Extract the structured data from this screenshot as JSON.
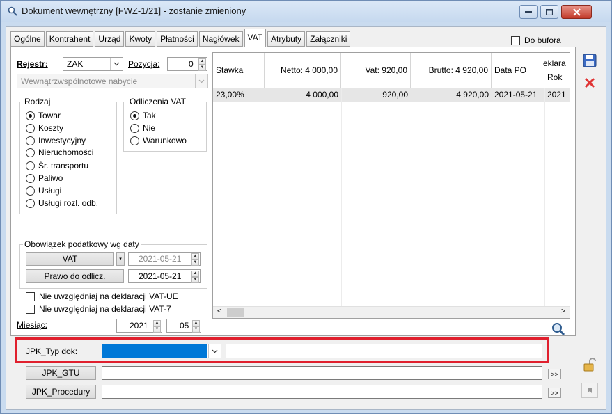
{
  "window": {
    "title": "Dokument wewnętrzny [FWZ-1/21]  - zostanie zmieniony"
  },
  "tabs": [
    "Ogólne",
    "Kontrahent",
    "Urząd",
    "Kwoty",
    "Płatności",
    "Nagłówek",
    "VAT",
    "Atrybuty",
    "Załączniki"
  ],
  "active_tab": "VAT",
  "do_bufora": "Do bufora",
  "rejestr": {
    "label": "Rejestr:",
    "value": "ZAK",
    "pozycja_label": "Pozycja:",
    "pozycja_value": "0",
    "type_value": "Wewnątrzwspólnotowe nabycie"
  },
  "rodzaj": {
    "title": "Rodzaj",
    "options": [
      "Towar",
      "Koszty",
      "Inwestycyjny",
      "Nieruchomości",
      "Śr. transportu",
      "Paliwo",
      "Usługi",
      "Usługi rozl. odb."
    ],
    "selected": "Towar"
  },
  "odliczenia": {
    "title": "Odliczenia VAT",
    "options": [
      "Tak",
      "Nie",
      "Warunkowo"
    ],
    "selected": "Tak"
  },
  "obowiazek": {
    "title": "Obowiązek podatkowy wg daty",
    "vat_button": "VAT",
    "vat_date": "2021-05-21",
    "prawo_button": "Prawo do odlicz.",
    "prawo_date": "2021-05-21"
  },
  "checks": {
    "vat_ue": "Nie uwzględniaj na deklaracji VAT-UE",
    "vat_7": "Nie uwzględniaj na deklaracji VAT-7"
  },
  "miesiac": {
    "label": "Miesiąc:",
    "year": "2021",
    "month": "05"
  },
  "grid": {
    "headers": [
      "Stawka",
      "Netto: 4 000,00",
      "Vat: 920,00",
      "Brutto: 4 920,00",
      "Data PO",
      "eklara Rok"
    ],
    "header_last_line1": "eklara",
    "header_last_line2": "Rok",
    "row": [
      "23,00%",
      "4 000,00",
      "920,00",
      "4 920,00",
      "2021-05-21",
      "2021"
    ]
  },
  "jpk": {
    "typ_label": "JPK_Typ dok:",
    "gtu_button": "JPK_GTU",
    "procedury_button": "JPK_Procedury",
    "more": ">>"
  },
  "colors": {
    "selection_blue": "#0078d7",
    "highlight_red": "#e0202e",
    "title_bar": "#c6d9ef"
  }
}
